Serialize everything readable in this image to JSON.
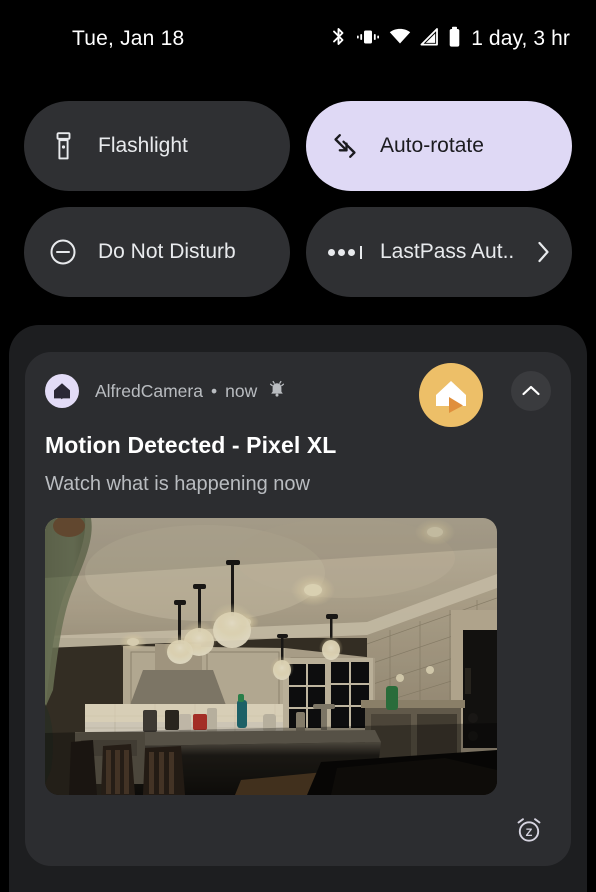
{
  "status_bar": {
    "date": "Tue, Jan 18",
    "battery_text": "1 day, 3 hr",
    "icons": [
      "bluetooth-icon",
      "vibrate-icon",
      "wifi-icon",
      "cellular-signal-icon",
      "battery-icon"
    ]
  },
  "quick_settings": {
    "tiles": [
      {
        "label": "Flashlight",
        "icon": "flashlight-icon",
        "active": false
      },
      {
        "label": "Auto-rotate",
        "icon": "auto-rotate-icon",
        "active": true
      },
      {
        "label": "Do Not Disturb",
        "icon": "do-not-disturb-icon",
        "active": false
      },
      {
        "label": "LastPass Aut..",
        "icon": "password-dots-icon",
        "active": false,
        "chevron": "chevron-right-icon"
      }
    ],
    "active_color": "#dfd9f5",
    "inactive_color": "#2f3033"
  },
  "notification": {
    "app_name": "AlfredCamera",
    "time": "now",
    "separator": "•",
    "alert_icon": "vibrating-bell-icon",
    "app_icon": "alfred-home-icon",
    "badge_icon": "alfred-camera-badge-icon",
    "badge_color": "#edbf68",
    "collapse_icon": "chevron-up-icon",
    "title": "Motion Detected - Pixel XL",
    "body": "Watch what is happening now",
    "snooze_icon": "snooze-alarm-icon",
    "image_alt": "Night kitchen camera snapshot with pendant lights and a person at left"
  }
}
